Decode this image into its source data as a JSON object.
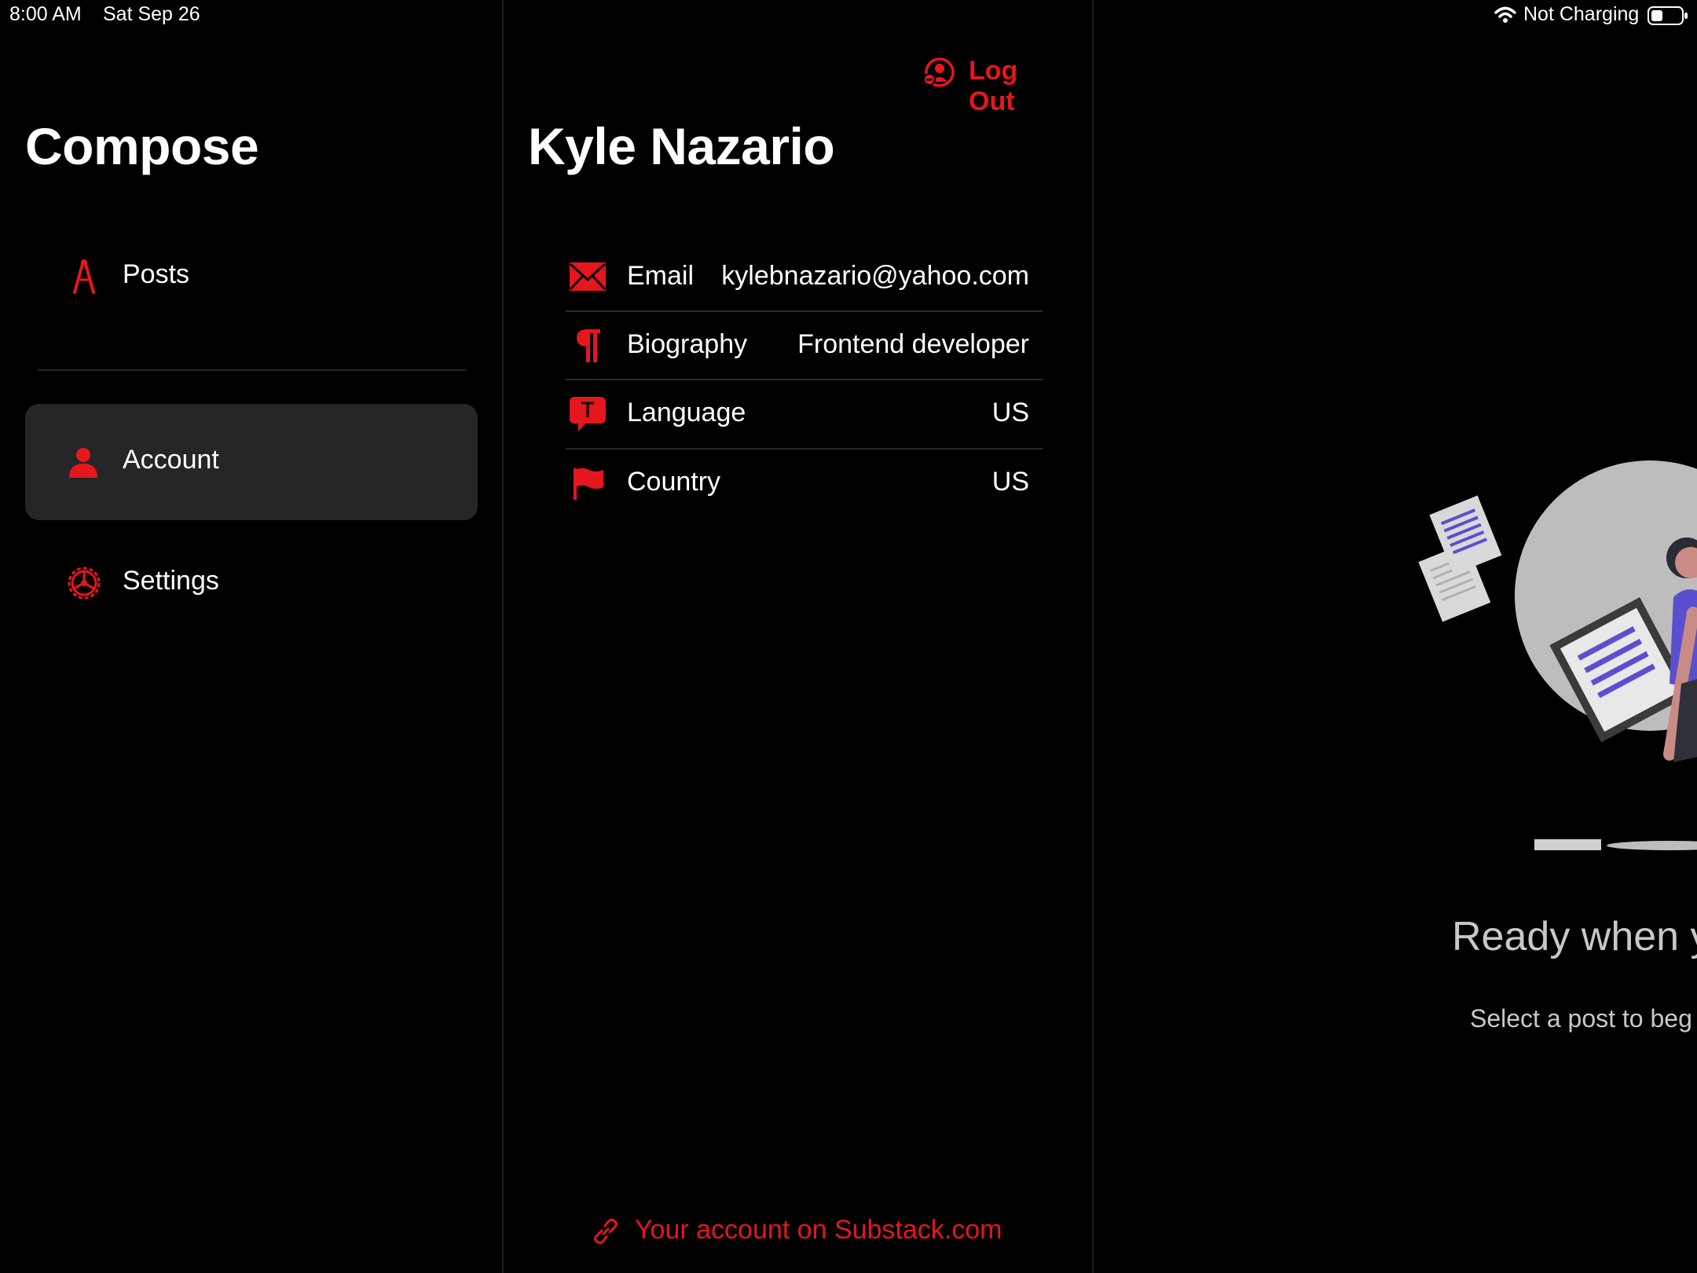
{
  "status_bar": {
    "time": "8:00 AM",
    "date": "Sat Sep 26",
    "battery_text": "Not Charging",
    "icons": [
      "wifi-icon",
      "battery-icon"
    ]
  },
  "sidebar": {
    "title": "Compose",
    "items": [
      {
        "label": "Posts",
        "icon": "compass-icon"
      },
      {
        "label": "Account",
        "icon": "person-icon",
        "selected": true
      },
      {
        "label": "Settings",
        "icon": "gear-icon"
      }
    ]
  },
  "account": {
    "logout_label": "Log Out",
    "name": "Kyle Nazario",
    "rows": [
      {
        "label": "Email",
        "value": "kylebnazario@yahoo.com",
        "icon": "envelope-icon"
      },
      {
        "label": "Biography",
        "value": "Frontend developer",
        "icon": "pilcrow-icon"
      },
      {
        "label": "Language",
        "value": "US",
        "icon": "text-bubble-icon"
      },
      {
        "label": "Country",
        "value": "US",
        "icon": "flag-icon"
      }
    ],
    "substack_link": "Your account on Substack.com"
  },
  "detail": {
    "empty_title": "Ready when y",
    "empty_subtitle": "Select a post to beg"
  },
  "colors": {
    "accent": "#e5161d",
    "background": "#000000",
    "selected_row": "#262628",
    "illustration_purple": "#5a4fcf"
  }
}
